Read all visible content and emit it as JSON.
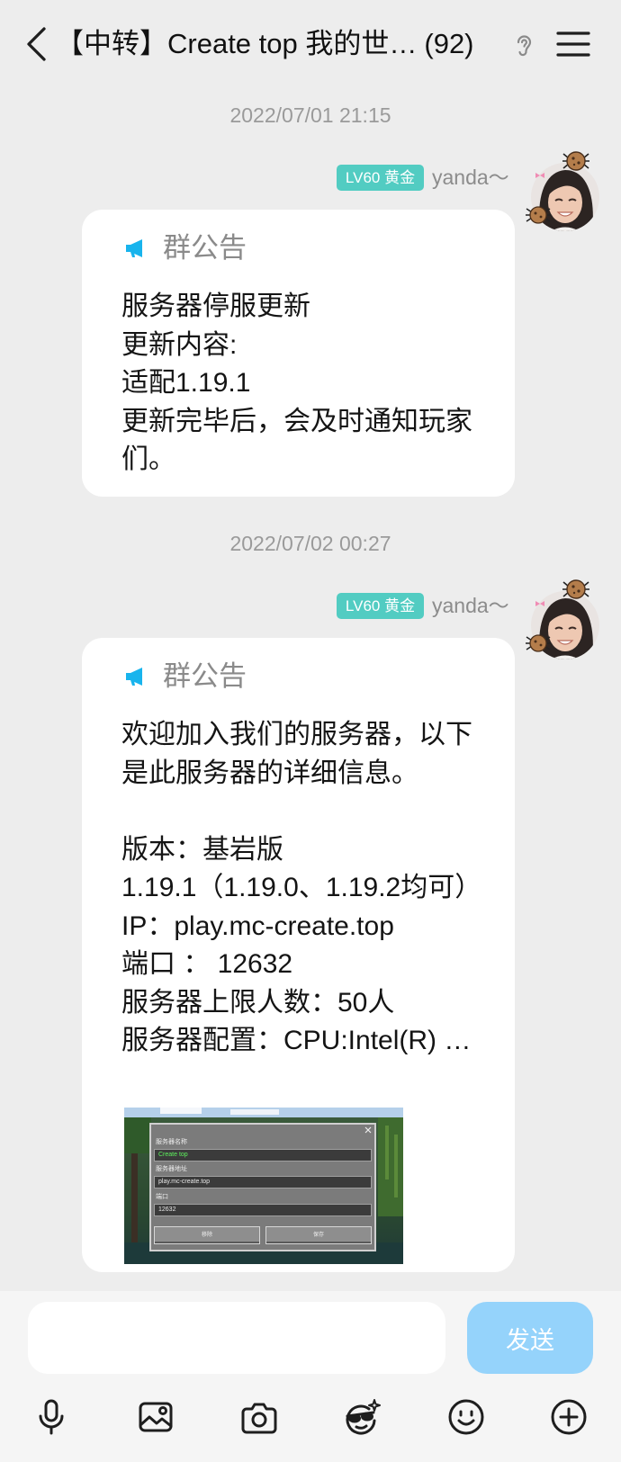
{
  "header": {
    "title": "【中转】Create top 我的世…",
    "member_count": "(92)",
    "icons": {
      "back": "chevron-left-icon",
      "ear": "ear-icon",
      "menu": "menu-icon"
    }
  },
  "messages": [
    {
      "time": "2022/07/01 21:15",
      "badge": "LV60 黄金",
      "sender": "yanda～",
      "notice_icon": "megaphone-icon",
      "notice_label": "群公告",
      "lines": [
        "服务器停服更新",
        "更新内容:",
        "适配1.19.1",
        "更新完毕后，会及时通知玩家",
        "们。"
      ]
    },
    {
      "time": "2022/07/02 00:27",
      "badge": "LV60 黄金",
      "sender": "yanda～",
      "notice_icon": "megaphone-icon",
      "notice_label": "群公告",
      "lines": [
        "欢迎加入我们的服务器，以下",
        "是此服务器的详细信息。",
        "版本：基岩版",
        "1.19.1（1.19.0、1.19.2均可）",
        "IP：play.mc-create.top",
        "端口 ： 12632",
        "服务器上限人数：50人",
        "服务器配置：CPU:Intel(R) …"
      ],
      "image": {
        "dialog": {
          "name_label": "服务器名称",
          "name_value": "Create top",
          "address_label": "服务器地址",
          "address_value": "play.mc-create.top",
          "port_label": "端口",
          "port_value": "12632",
          "remove_label": "移除",
          "save_label": "保存",
          "close_icon": "close-icon"
        }
      }
    }
  ],
  "composer": {
    "input_value": "",
    "send_label": "发送"
  },
  "toolbar": {
    "icons": [
      "microphone-icon",
      "image-icon",
      "camera-icon",
      "sparkle-face-icon",
      "smiley-icon",
      "plus-circle-icon"
    ]
  },
  "theme": {
    "bg": "#ededed",
    "bubble": "#ffffff",
    "accent": "#18b4ed",
    "badge": "#52ccc2",
    "send": "#95d3fb",
    "text": "#141414",
    "muted": "#9a9a9a"
  }
}
